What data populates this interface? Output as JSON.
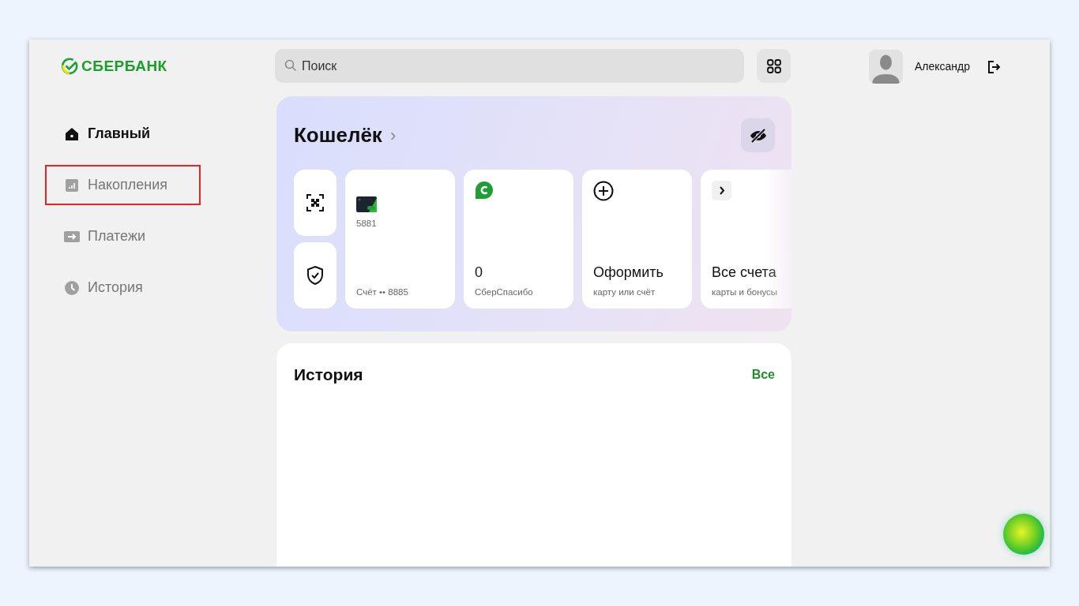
{
  "logo": {
    "text": "СБЕРБАНК"
  },
  "nav": [
    {
      "label": "Главный",
      "kind": "home",
      "selected": true,
      "outlined": false
    },
    {
      "label": "Накопления",
      "kind": "savings",
      "selected": false,
      "outlined": true
    },
    {
      "label": "Платежи",
      "kind": "payments",
      "selected": false,
      "outlined": false
    },
    {
      "label": "История",
      "kind": "history",
      "selected": false,
      "outlined": false
    }
  ],
  "search": {
    "placeholder": "Поиск"
  },
  "user": {
    "name": "Александр"
  },
  "wallet": {
    "title": "Кошелёк",
    "chevron": "›",
    "cards": [
      {
        "kind": "account",
        "number": "5881",
        "caption": "Счёт •• 8885"
      },
      {
        "kind": "bonus",
        "title": "0",
        "caption": "СберСпасибо"
      },
      {
        "kind": "add",
        "title": "Оформить",
        "caption": "карту или счёт"
      },
      {
        "kind": "all",
        "title": "Все счета",
        "caption": "карты и бонусы"
      }
    ]
  },
  "history": {
    "title": "История",
    "link": "Все"
  }
}
